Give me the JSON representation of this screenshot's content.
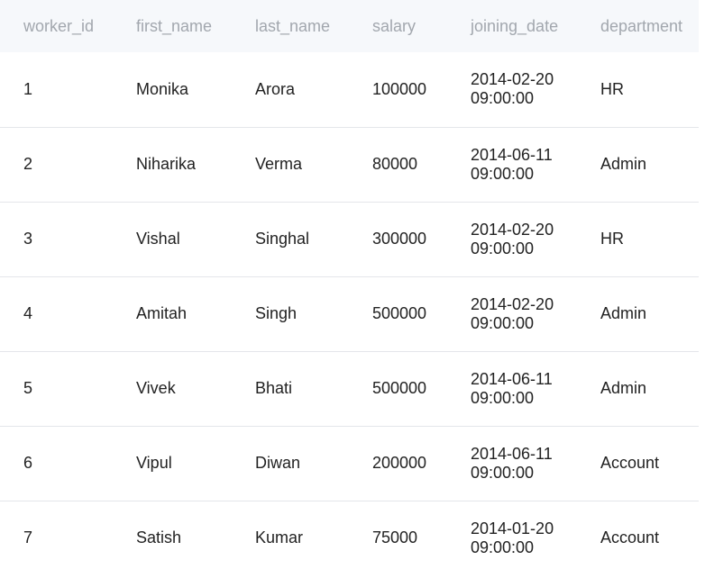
{
  "table": {
    "columns": [
      "worker_id",
      "first_name",
      "last_name",
      "salary",
      "joining_date",
      "department"
    ],
    "rows": [
      {
        "worker_id": "1",
        "first_name": "Monika",
        "last_name": "Arora",
        "salary": "100000",
        "date": "2014-02-20",
        "time": "09:00:00",
        "department": "HR"
      },
      {
        "worker_id": "2",
        "first_name": "Niharika",
        "last_name": "Verma",
        "salary": "80000",
        "date": "2014-06-11",
        "time": "09:00:00",
        "department": "Admin"
      },
      {
        "worker_id": "3",
        "first_name": "Vishal",
        "last_name": "Singhal",
        "salary": "300000",
        "date": "2014-02-20",
        "time": "09:00:00",
        "department": "HR"
      },
      {
        "worker_id": "4",
        "first_name": "Amitah",
        "last_name": "Singh",
        "salary": "500000",
        "date": "2014-02-20",
        "time": "09:00:00",
        "department": "Admin"
      },
      {
        "worker_id": "5",
        "first_name": "Vivek",
        "last_name": "Bhati",
        "salary": "500000",
        "date": "2014-06-11",
        "time": "09:00:00",
        "department": "Admin"
      },
      {
        "worker_id": "6",
        "first_name": "Vipul",
        "last_name": "Diwan",
        "salary": "200000",
        "date": "2014-06-11",
        "time": "09:00:00",
        "department": "Account"
      },
      {
        "worker_id": "7",
        "first_name": "Satish",
        "last_name": "Kumar",
        "salary": "75000",
        "date": "2014-01-20",
        "time": "09:00:00",
        "department": "Account"
      }
    ]
  }
}
